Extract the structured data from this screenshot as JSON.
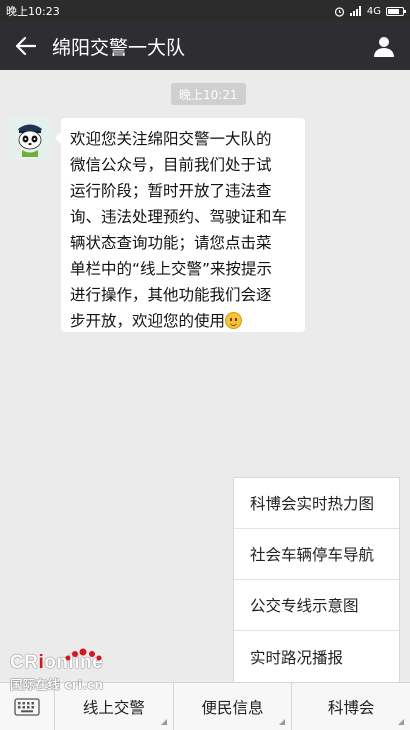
{
  "status_bar": {
    "time": "晚上10:23",
    "network": "4G"
  },
  "header": {
    "title": "绵阳交警一大队"
  },
  "chat": {
    "timestamp": "晚上10:21",
    "message_lines": [
      "欢迎您关注绵阳交警一大队的",
      "微信公众号，目前我们处于试",
      "运行阶段；暂时开放了违法查",
      "询、违法处理预约、驾驶证和车",
      "辆状态查询功能；请您点击菜",
      "单栏中的“线上交警”来按提示",
      "进行操作，其他功能我们会逐",
      "步开放，欢迎您的使用"
    ]
  },
  "popup_menu": {
    "items": [
      "科博会实时热力图",
      "社会车辆停车导航",
      "公交专线示意图",
      "实时路况播报"
    ]
  },
  "bottom_menu": {
    "tabs": [
      "线上交警",
      "便民信息",
      "科博会"
    ]
  },
  "watermark": {
    "logo_cr": "CR",
    "logo_i": "i",
    "logo_online": "online",
    "sub": "国际在线 cri.cn"
  },
  "colors": {
    "header_bg": "#2e2e32",
    "chat_bg": "#ebebeb",
    "bubble_bg": "#ffffff",
    "watermark_red": "#d2171d"
  }
}
